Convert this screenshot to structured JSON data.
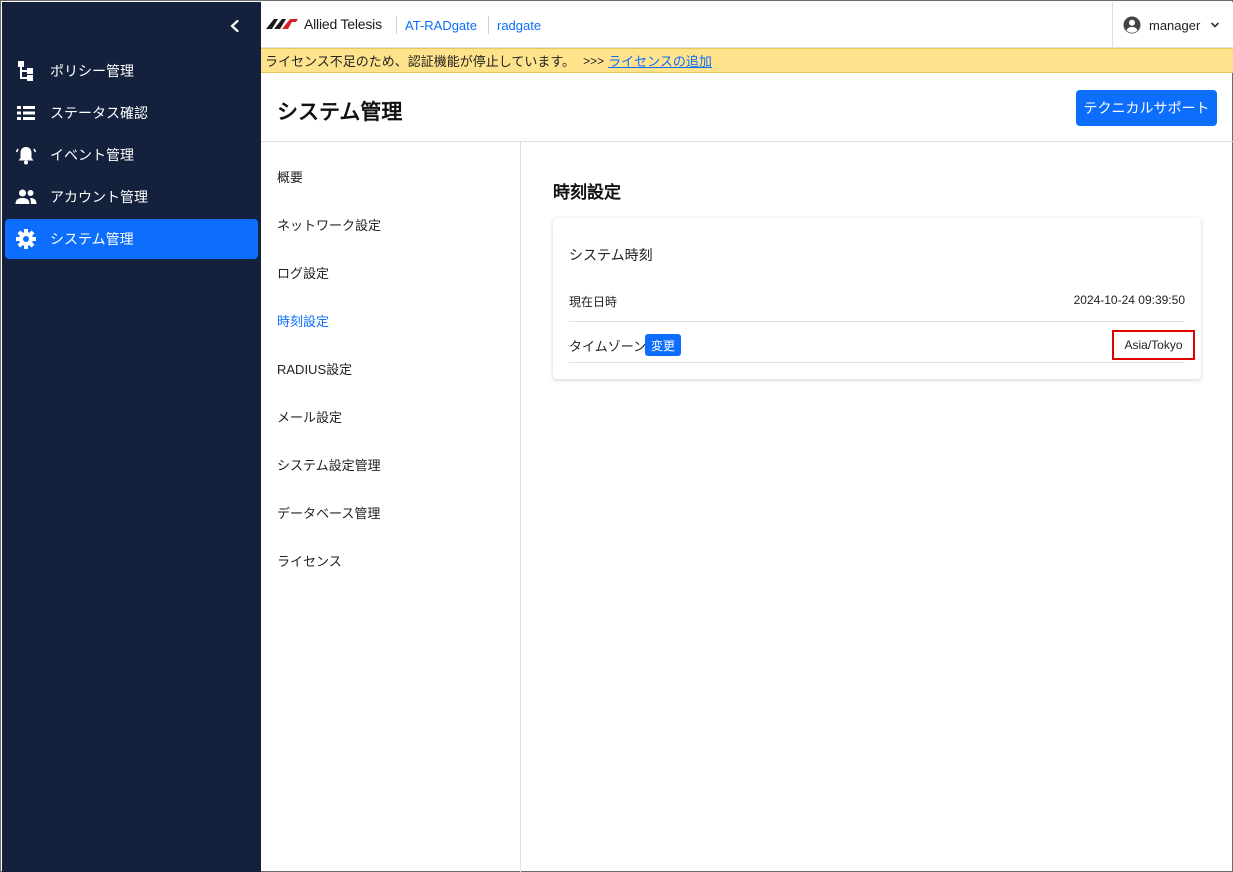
{
  "sidebar": {
    "items": [
      {
        "label": "ポリシー管理",
        "icon": "policy-tree-icon",
        "active": false
      },
      {
        "label": "ステータス確認",
        "icon": "list-icon",
        "active": false
      },
      {
        "label": "イベント管理",
        "icon": "bell-icon",
        "active": false
      },
      {
        "label": "アカウント管理",
        "icon": "users-icon",
        "active": false
      },
      {
        "label": "システム管理",
        "icon": "gear-icon",
        "active": true
      }
    ]
  },
  "header": {
    "logo_text": "Allied Telesis",
    "product": "AT-RADgate",
    "host": "radgate",
    "user": "manager"
  },
  "banner": {
    "message": "ライセンス不足のため、認証機能が停止しています。",
    "arrows": ">>>",
    "link": "ライセンスの追加"
  },
  "page": {
    "title": "システム管理",
    "support_button": "テクニカルサポート"
  },
  "subnav": {
    "items": [
      "概要",
      "ネットワーク設定",
      "ログ設定",
      "時刻設定",
      "RADIUS設定",
      "メール設定",
      "システム設定管理",
      "データベース管理",
      "ライセンス"
    ],
    "active_index": 3
  },
  "content": {
    "title": "時刻設定",
    "card_title": "システム時刻",
    "current_label": "現在日時",
    "current_value": "2024-10-24 09:39:50",
    "timezone_label": "タイムゾーン",
    "change_button": "変更",
    "timezone_value": "Asia/Tokyo"
  },
  "colors": {
    "sidebar_bg": "#14213d",
    "accent": "#0d6efd",
    "banner_bg": "#ffe38c",
    "highlight": "#e00000"
  }
}
